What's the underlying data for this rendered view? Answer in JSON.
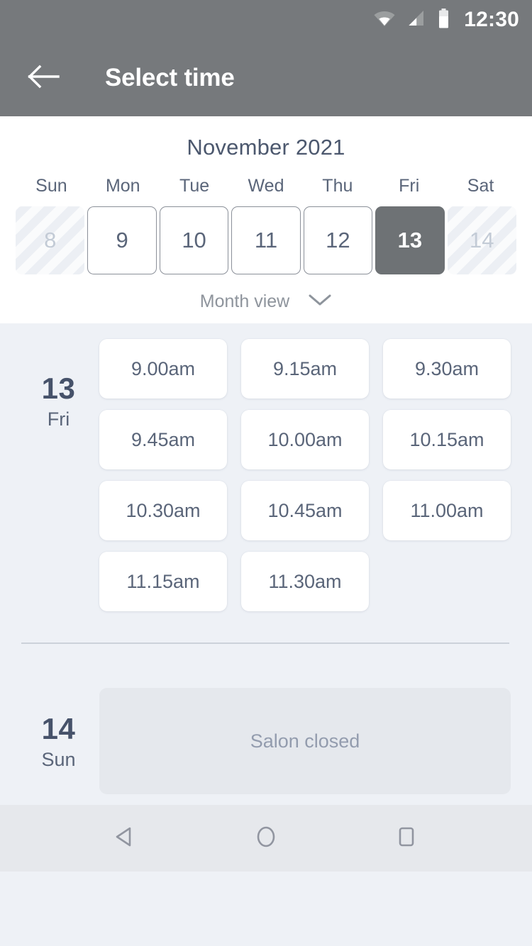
{
  "status_bar": {
    "time": "12:30",
    "icons": [
      "wifi-icon",
      "signal-icon",
      "battery-icon"
    ]
  },
  "app_bar": {
    "back_icon": "arrow-left-icon",
    "title": "Select time"
  },
  "calendar": {
    "month_title": "November 2021",
    "weekdays": [
      "Sun",
      "Mon",
      "Tue",
      "Wed",
      "Thu",
      "Fri",
      "Sat"
    ],
    "days": [
      {
        "number": "8",
        "state": "disabled"
      },
      {
        "number": "9",
        "state": "enabled"
      },
      {
        "number": "10",
        "state": "enabled"
      },
      {
        "number": "11",
        "state": "enabled"
      },
      {
        "number": "12",
        "state": "enabled"
      },
      {
        "number": "13",
        "state": "selected"
      },
      {
        "number": "14",
        "state": "disabled"
      }
    ],
    "view_toggle": {
      "label": "Month view",
      "icon": "chevron-down-icon"
    }
  },
  "schedule": [
    {
      "day_number": "13",
      "day_name": "Fri",
      "slots": [
        "9.00am",
        "9.15am",
        "9.30am",
        "9.45am",
        "10.00am",
        "10.15am",
        "10.30am",
        "10.45am",
        "11.00am",
        "11.15am",
        "11.30am"
      ]
    },
    {
      "day_number": "14",
      "day_name": "Sun",
      "closed_message": "Salon closed"
    }
  ],
  "nav_bar": {
    "back": "triangle-back-icon",
    "home": "circle-home-icon",
    "recents": "square-recents-icon"
  },
  "colors": {
    "header_gray": "#76797c",
    "selected_day": "#6e7275",
    "text_dark": "#46526a",
    "text_muted": "#5a6579",
    "content_bg": "#eef1f6",
    "chip_bg": "#ffffff",
    "closed_bg": "#e5e8ed"
  }
}
